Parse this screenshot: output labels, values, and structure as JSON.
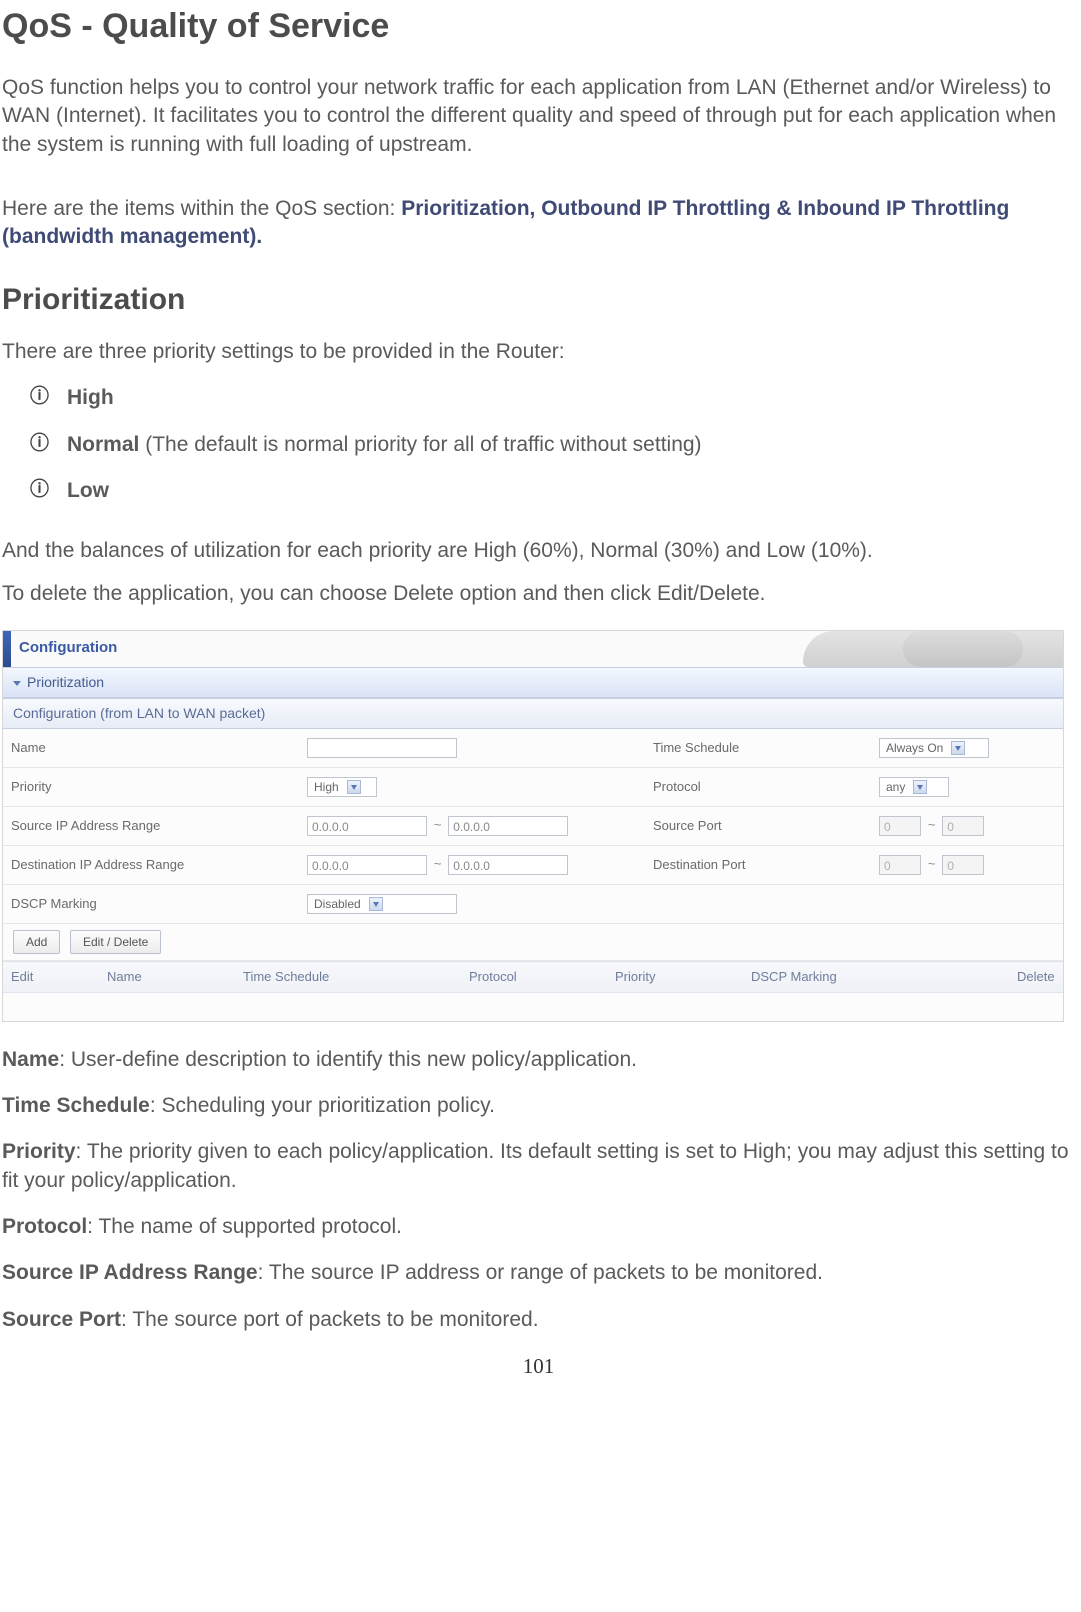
{
  "title": "QoS - Quality of Service",
  "intro": "QoS function helps you to control your network traffic for each application from LAN (Ethernet and/or Wireless) to WAN (Internet).  It facilitates you to control the different quality and speed of through put for each application when the system is running with full loading of upstream.",
  "items_intro_prefix": "Here are the items within the QoS section: ",
  "items_intro_bold": "Prioritization, Outbound IP Throttling & Inbound IP Throttling (bandwidth management).",
  "prioritization_heading": "Prioritization",
  "prioritization_intro": "There are three priority settings to be provided in the Router:",
  "bullets": {
    "high": "High",
    "normal_bold": "Normal",
    "normal_rest": " (The default is normal priority for all of traffic without setting)",
    "low": "Low"
  },
  "balances": "And the balances of utilization for each priority are High (60%), Normal (30%) and Low (10%).",
  "delete_note": "To delete the application, you can choose Delete option and then click Edit/Delete.",
  "fig": {
    "config_title": "Configuration",
    "section": "Prioritization",
    "subsection": "Configuration (from LAN to WAN packet)",
    "rows": {
      "name_label": "Name",
      "name_value": "",
      "time_label": "Time Schedule",
      "time_value": "Always On",
      "priority_label": "Priority",
      "priority_value": "High",
      "protocol_label": "Protocol",
      "protocol_value": "any",
      "srcip_label": "Source IP Address Range",
      "srcip_a": "0.0.0.0",
      "srcip_b": "0.0.0.0",
      "srcport_label": "Source Port",
      "srcport_a": "0",
      "srcport_b": "0",
      "dstip_label": "Destination IP Address Range",
      "dstip_a": "0.0.0.0",
      "dstip_b": "0.0.0.0",
      "dstport_label": "Destination Port",
      "dstport_a": "0",
      "dstport_b": "0",
      "dscp_label": "DSCP Marking",
      "dscp_value": "Disabled"
    },
    "buttons": {
      "add": "Add",
      "edit": "Edit / Delete"
    },
    "headers": {
      "edit": "Edit",
      "name": "Name",
      "time": "Time Schedule",
      "protocol": "Protocol",
      "priority": "Priority",
      "dscp": "DSCP Marking",
      "delete": "Delete"
    }
  },
  "defs": {
    "name_t": "Name",
    "name_b": ": User-define description to identify this new policy/application.",
    "time_t": "Time Schedule",
    "time_b": ": Scheduling your prioritization policy.",
    "prio_t": "Priority",
    "prio_b": ": The priority given to each policy/application. Its default setting is set to High; you may adjust this setting to fit your policy/application.",
    "proto_t": "Protocol",
    "proto_b": ": The name of supported protocol.",
    "srcip_t": "Source IP Address Range",
    "srcip_b": ": The source IP address or range of packets to be monitored.",
    "srcport_t": "Source Port",
    "srcport_b": ": The source port of packets to be monitored."
  },
  "page_number": "101",
  "range_sep": "~"
}
